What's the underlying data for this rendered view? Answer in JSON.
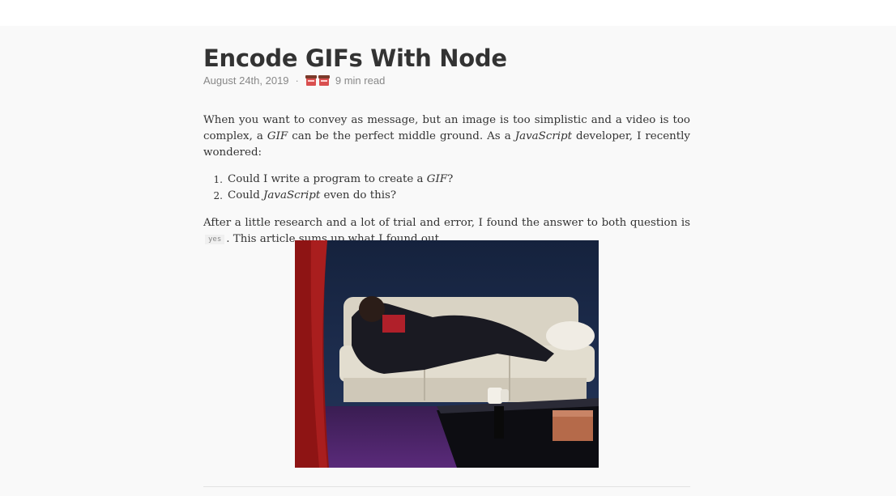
{
  "article": {
    "title": "Encode GIFs With Node",
    "date": "August 24th, 2019",
    "separator": "·",
    "read_time": "9 min read",
    "paragraph1": {
      "part1": "When you want to convey as message, but an image is too simplistic and a video is too complex, a ",
      "gif": "GIF",
      "part2": " can be the perfect middle ground. As a ",
      "js": "JavaScript",
      "part3": " developer, I recently wondered:"
    },
    "list": [
      {
        "num": "1.",
        "before": "Could I write a program to create a ",
        "em": "GIF",
        "after": "?"
      },
      {
        "num": "2.",
        "before": "Could ",
        "em": "JavaScript",
        "after": " even do this?"
      }
    ],
    "paragraph2": {
      "part1": "After a little research and a lot of trial and error, I found the answer to both question is ",
      "code": "yes",
      "part2": ". This article sums up what I found out."
    }
  },
  "icons": {
    "meta_emoji": "popcorn-icon"
  }
}
